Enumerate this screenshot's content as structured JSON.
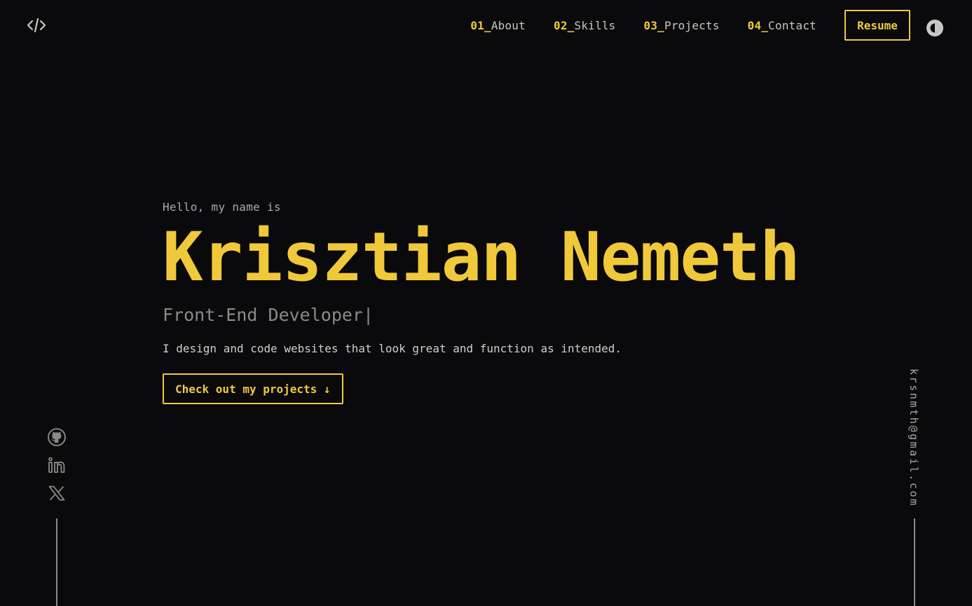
{
  "header": {
    "logo_icon": "code-brackets-icon",
    "nav": [
      {
        "num": "01_",
        "label": "About"
      },
      {
        "num": "02_",
        "label": "Skills"
      },
      {
        "num": "03_",
        "label": "Projects"
      },
      {
        "num": "04_",
        "label": "Contact"
      }
    ],
    "resume_label": "Resume",
    "theme_icon": "theme-toggle-icon"
  },
  "hero": {
    "greeting": "Hello, my name is",
    "name": "Krisztian Nemeth",
    "role": "Front-End Developer|",
    "tagline": "I design and code websites that look great and function as intended.",
    "cta_label": "Check out my projects ↓"
  },
  "socials": [
    "github-icon",
    "linkedin-icon",
    "x-icon"
  ],
  "email": "krsnmth@gmail.com",
  "colors": {
    "background": "#0a0a0c",
    "accent": "#f0c93b",
    "text_muted": "#a9a9a9",
    "text": "#cfcfcf"
  }
}
